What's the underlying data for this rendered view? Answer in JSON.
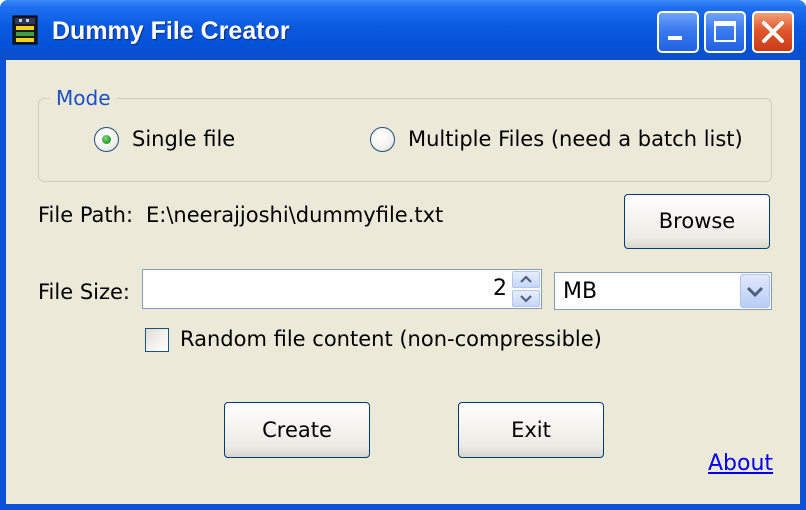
{
  "window": {
    "title": "Dummy File Creator",
    "icon": "app-icon",
    "controls": {
      "minimize": "minimize-icon",
      "maximize": "maximize-icon",
      "close": "close-icon"
    }
  },
  "mode_group": {
    "legend": "Mode",
    "options": [
      {
        "label": "Single file",
        "selected": true
      },
      {
        "label": "Multiple Files (need a batch list)",
        "selected": false
      }
    ]
  },
  "file_path": {
    "label": "File Path:",
    "value": "E:\\neerajjoshi\\dummyfile.txt",
    "browse_label": "Browse"
  },
  "file_size": {
    "label": "File Size:",
    "value": "2",
    "unit_selected": "MB"
  },
  "random_content": {
    "label": "Random file content (non-compressible)",
    "checked": false
  },
  "actions": {
    "create_label": "Create",
    "exit_label": "Exit",
    "about_link": "About"
  },
  "colors": {
    "titlebar": "#0a5ae0",
    "client_bg": "#ece9d8",
    "group_legend": "#1b4fc8",
    "link": "#0000ee",
    "close_button": "#e2572c"
  }
}
